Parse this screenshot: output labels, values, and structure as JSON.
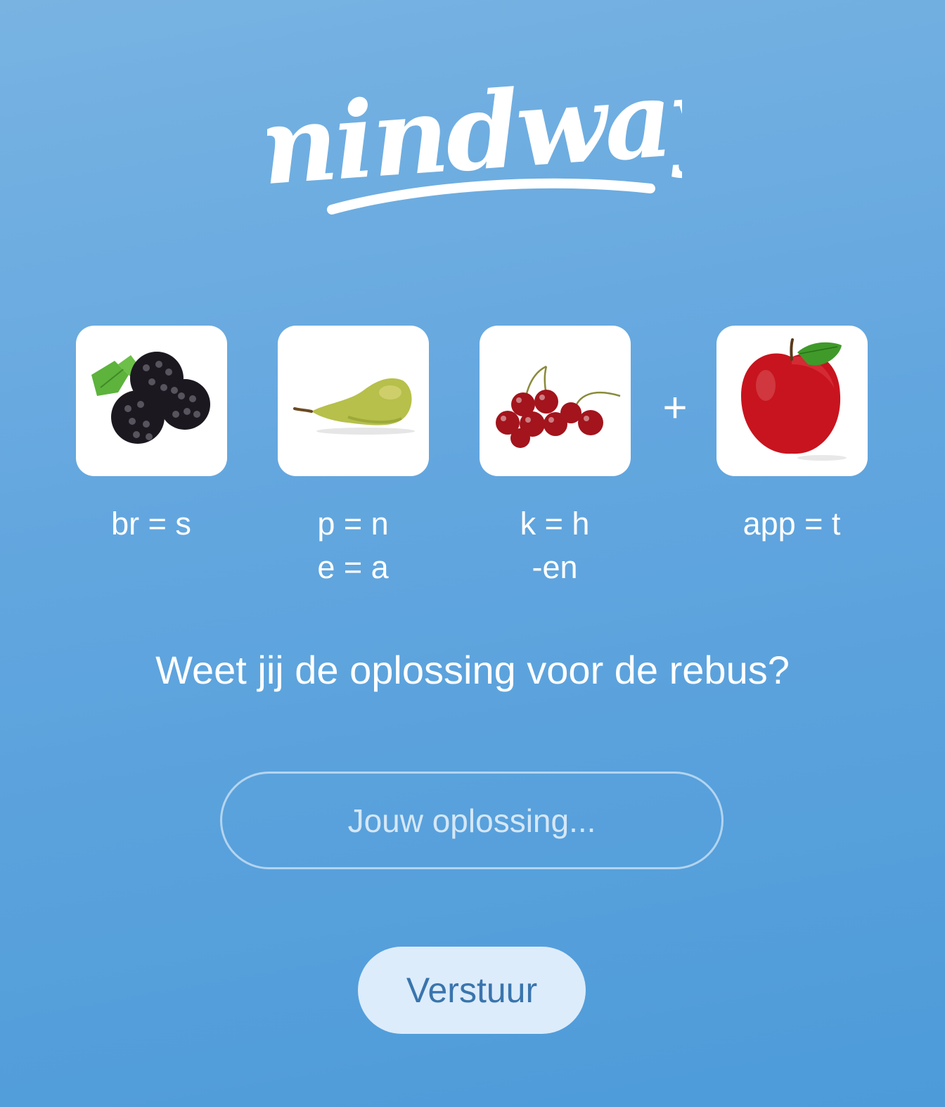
{
  "brand": {
    "logo_text": "mindway"
  },
  "rebus": {
    "items": [
      {
        "fruit": "blackberries",
        "lines": [
          "br = s",
          ""
        ]
      },
      {
        "fruit": "pear",
        "lines": [
          "p = n",
          "e = a"
        ]
      },
      {
        "fruit": "cherries",
        "lines": [
          "k = h",
          "-en"
        ]
      },
      {
        "fruit": "apple",
        "lines": [
          "app = t",
          ""
        ]
      }
    ],
    "operator": "+"
  },
  "question": "Weet jij de oplossing voor de rebus?",
  "answer": {
    "value": "",
    "placeholder": "Jouw oplossing..."
  },
  "submit_label": "Verstuur",
  "colors": {
    "background_top": "#78b3e2",
    "background_bottom": "#4d9bd9",
    "button_bg": "#dcecfb",
    "button_text": "#3a74ad"
  }
}
